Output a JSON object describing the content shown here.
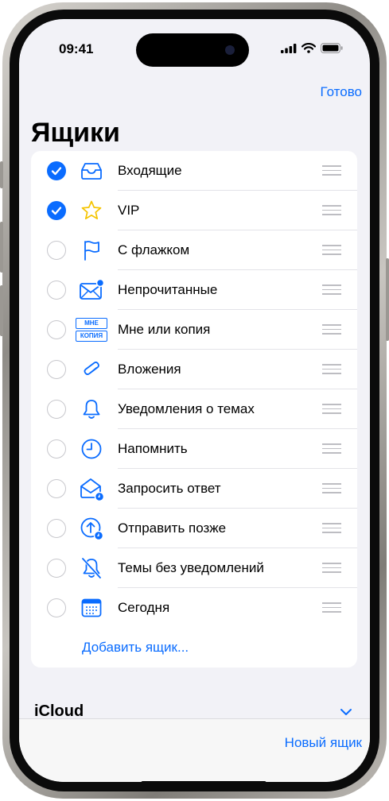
{
  "status": {
    "time": "09:41"
  },
  "header": {
    "done_label": "Готово",
    "title": "Ящики"
  },
  "mailboxes": [
    {
      "label": "Входящие",
      "checked": true,
      "icon": "tray-icon"
    },
    {
      "label": "VIP",
      "checked": true,
      "icon": "star-icon"
    },
    {
      "label": "С флажком",
      "checked": false,
      "icon": "flag-icon"
    },
    {
      "label": "Непрочитанные",
      "checked": false,
      "icon": "unread-envelope-icon"
    },
    {
      "label": "Мне или копия",
      "checked": false,
      "icon": "to-cc-icon",
      "badge_top": "МНЕ",
      "badge_bottom": "КОПИЯ"
    },
    {
      "label": "Вложения",
      "checked": false,
      "icon": "paperclip-icon"
    },
    {
      "label": "Уведомления о темах",
      "checked": false,
      "icon": "bell-icon"
    },
    {
      "label": "Напомнить",
      "checked": false,
      "icon": "clock-icon"
    },
    {
      "label": "Запросить ответ",
      "checked": false,
      "icon": "envelope-clock-icon"
    },
    {
      "label": "Отправить позже",
      "checked": false,
      "icon": "send-later-icon"
    },
    {
      "label": "Темы без уведомлений",
      "checked": false,
      "icon": "bell-slash-icon"
    },
    {
      "label": "Сегодня",
      "checked": false,
      "icon": "calendar-icon"
    }
  ],
  "add_mailbox_label": "Добавить ящик...",
  "section": {
    "title": "iCloud"
  },
  "toolbar": {
    "new_mailbox_label": "Новый ящик"
  },
  "colors": {
    "accent": "#0a6cff",
    "background": "#f2f2f7"
  }
}
